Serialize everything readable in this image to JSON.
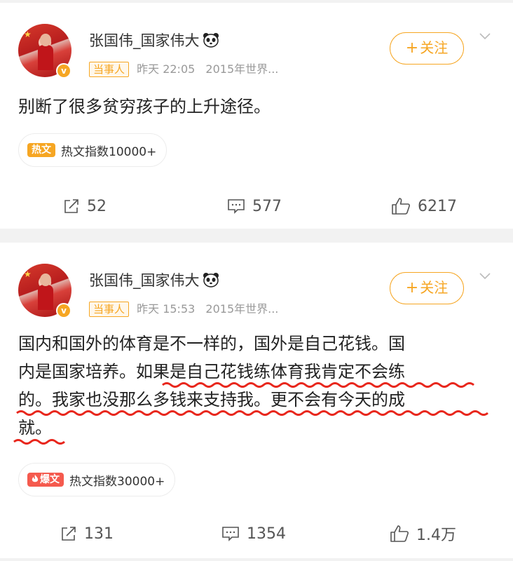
{
  "posts": [
    {
      "username": "张国伟_国家伟大",
      "tag": "当事人",
      "time": "昨天 22:05",
      "source": "2015年世界...",
      "follow_label": "关注",
      "content_lines": [
        "别断了很多贫穷孩子的上升途径。"
      ],
      "hot_badge": "热文",
      "hot_text": "热文指数10000+",
      "reposts": "52",
      "comments": "577",
      "likes": "6217"
    },
    {
      "username": "张国伟_国家伟大",
      "tag": "当事人",
      "time": "昨天 15:53",
      "source": "2015年世界...",
      "follow_label": "关注",
      "content_lines": [
        "国内和国外的体育是不一样的，国外是自己花钱。国",
        "内是国家培养。如果是自己花钱练体育我肯定不会练",
        "的。我家也没那么多钱来支持我。更不会有今天的成",
        "就。"
      ],
      "hot_badge": "爆文",
      "hot_text": "热文指数30000+",
      "reposts": "131",
      "comments": "1354",
      "likes": "1.4万"
    }
  ],
  "colors": {
    "accent": "#f6a623",
    "hot_badge_1": "#f6a623",
    "hot_badge_2": "#f55a4e",
    "underline": "#e8261c",
    "background": "#f2f2f2"
  },
  "icons": [
    "panda-emoji-icon",
    "verified-v-icon",
    "plus-icon",
    "chevron-down-icon",
    "repost-icon",
    "comment-icon",
    "like-icon",
    "fire-icon"
  ]
}
